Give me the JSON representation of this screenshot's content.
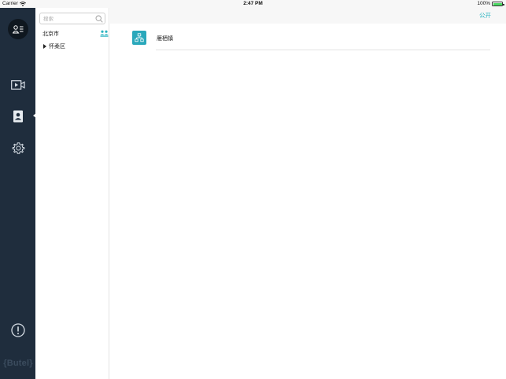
{
  "status_bar": {
    "carrier": "Carrier",
    "time": "2:47 PM",
    "battery_percent": "100%",
    "battery_level": 1.0
  },
  "nav": {
    "items": [
      {
        "name": "profile",
        "icon": "user-list-icon"
      },
      {
        "name": "video",
        "icon": "video-play-icon"
      },
      {
        "name": "contacts",
        "icon": "contact-book-icon",
        "active": true
      },
      {
        "name": "settings",
        "icon": "gear-icon"
      },
      {
        "name": "about",
        "icon": "exclamation-circle-icon"
      }
    ],
    "logo_text": "{Butel}"
  },
  "tree": {
    "search": {
      "placeholder": "搜索",
      "value": ""
    },
    "city": "北京市",
    "district": "怀柔区"
  },
  "main": {
    "header_action": "公开",
    "items": [
      {
        "name": "雁栖镇",
        "icon": "org-chart-icon"
      }
    ]
  },
  "colors": {
    "nav_bg": "#1f2d3d",
    "accent": "#2bb3c0",
    "org_icon_bg": "#2aa8bb",
    "battery": "#4cd964"
  }
}
